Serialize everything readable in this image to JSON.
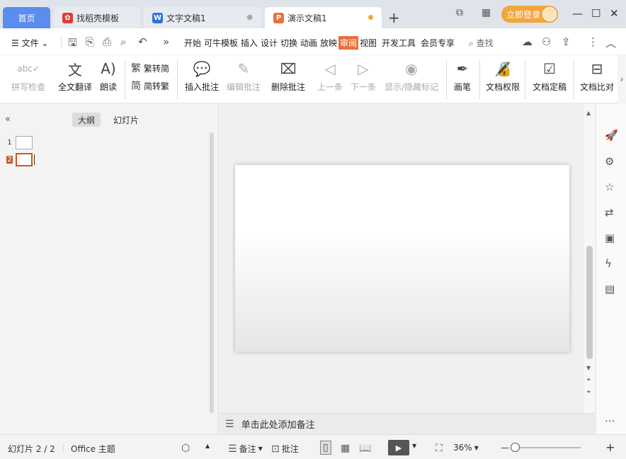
{
  "tabs": {
    "home": "首页",
    "t1": {
      "label": "找稻壳模板"
    },
    "t2": {
      "label": "文字文稿1",
      "icon_letter": "W"
    },
    "t3": {
      "label": "演示文稿1",
      "icon_letter": "P"
    },
    "new_tab": "+",
    "login": "立即登录"
  },
  "menu": {
    "file": "文件",
    "items": [
      "开始",
      "可牛模板",
      "插入",
      "设计",
      "切换",
      "动画",
      "放映",
      "审阅",
      "视图",
      "开发工具",
      "会员专享"
    ],
    "active": "审阅",
    "search": "查找"
  },
  "ribbon": {
    "spell": "拼写检查",
    "translate": "全文翻译",
    "read": "朗读",
    "trad_to_simp": "繁转简",
    "simp_to_trad": "简转繁",
    "insert_comment": "插入批注",
    "edit_comment": "编辑批注",
    "delete_comment": "删除批注",
    "prev": "上一条",
    "next": "下一条",
    "show_hide": "显示/隐藏标记",
    "pen": "画笔",
    "permission": "文档权限",
    "finalize": "文档定稿",
    "compare": "文档比对"
  },
  "panel": {
    "outline_tab": "大纲",
    "slides_tab": "幻灯片",
    "slides": [
      "1",
      "2"
    ]
  },
  "notes_placeholder": "单击此处添加备注",
  "status": {
    "slide_info": "幻灯片 2 / 2",
    "theme": "Office 主题",
    "notes": "备注",
    "comments": "批注",
    "zoom": "36%"
  },
  "colors": {
    "accent": "#e8703a",
    "home_tab": "#5b8def",
    "login": "#f2a63b"
  }
}
